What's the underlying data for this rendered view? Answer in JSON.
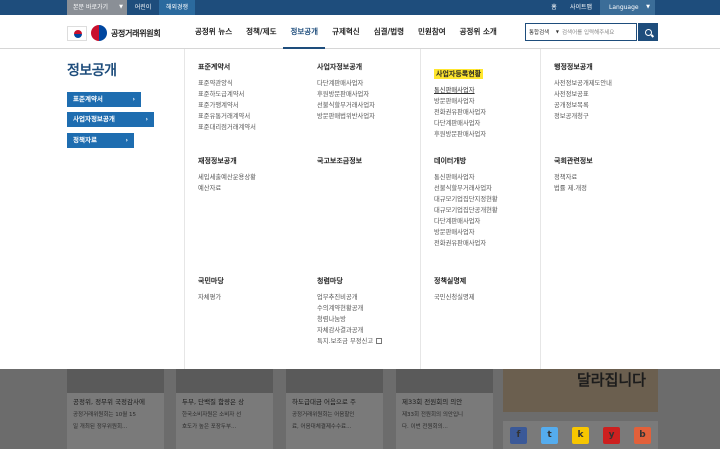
{
  "utility": {
    "skip": "본문 바로가기",
    "easy": "어린이",
    "abroad": "해외경쟁",
    "home": "홈",
    "sitemap": "사이트맵",
    "language": "Language"
  },
  "header": {
    "logo_text": "공정거래위원회",
    "nav": [
      "공정위 뉴스",
      "정책/제도",
      "정보공개",
      "규제혁신",
      "심결/법령",
      "민원참여",
      "공정위 소개"
    ],
    "search_select": "통합검색",
    "search_placeholder": "검색어를 입력해주세요"
  },
  "mega": {
    "title": "정보공개",
    "side_buttons": [
      "표준계약서",
      "사업자정보공개",
      "정책자료"
    ],
    "groups": [
      {
        "head": "표준계약서",
        "items": [
          "표준약관양식",
          "표준하도급계약서",
          "표준가맹계약서",
          "표준유통거래계약서",
          "표준대리점거래계약서"
        ]
      },
      {
        "head": "사업자정보공개",
        "items": [
          "다단계판매사업자",
          "후원방문판매사업자",
          "선불식할부거래사업자",
          "방문판매법위반사업자"
        ]
      },
      {
        "head": "사업자등록현황",
        "items": [
          "통신판매사업자",
          "방문판매사업자",
          "전화권유판매사업자",
          "다단계판매사업자",
          "후원방문판매사업자"
        ]
      },
      {
        "head": "행정정보공개",
        "items": [
          "사전정보공개제도안내",
          "사전정보공표",
          "공개정보목록",
          "정보공개청구"
        ]
      },
      {
        "head": "재정정보공개",
        "items": [
          "세입세출예산운용상황",
          "예산자료"
        ]
      },
      {
        "head": "국고보조금정보",
        "items": []
      },
      {
        "head": "데이터개방",
        "items": [
          "통신판매사업자",
          "선불식할부거래사업자",
          "대규모기업집단지정현황",
          "대규모기업집단공개현황",
          "다단계판매사업자",
          "방문판매사업자",
          "전화권유판매사업자"
        ]
      },
      {
        "head": "국회관련정보",
        "items": [
          "정책자료",
          "법률 제.개정"
        ]
      },
      {
        "head": "국민마당",
        "items": [
          "자체평가"
        ]
      },
      {
        "head": "청렴마당",
        "items": [
          "업무추진비공개",
          "수의계약현황공개",
          "청렴나눔방",
          "자체감사결과공개",
          "특지.보조금 부정신고"
        ]
      },
      {
        "head": "정책실명제",
        "items": [
          "국민신청실명제"
        ]
      }
    ]
  },
  "below": {
    "cards": [
      {
        "title": "공정위, 정무위 국정감사에",
        "desc1": "공정거래위원회는 10월 15",
        "desc2": "일 개최된 정무위원회..."
      },
      {
        "title": "두부, 단백질 함량은 상",
        "desc1": "한국소비자원은 소비자 선",
        "desc2": "호도가 높은 포장두부..."
      },
      {
        "title": "하도급대금 어음으로 주",
        "desc1": "공정거래위원회는 어음할인",
        "desc2": "료, 어음대체결제수수료..."
      },
      {
        "title": "제33회 전원회의 의안",
        "desc1": "제33회 전원회의 의안입니",
        "desc2": "다. 이번 전원회의..."
      }
    ],
    "banner_text": "달라집니다",
    "sns": [
      "f",
      "t",
      "k",
      "y",
      "b"
    ]
  },
  "colors": {
    "primary": "#1e4d7c",
    "accent": "#1e6db0",
    "highlight": "#ffe62e"
  }
}
